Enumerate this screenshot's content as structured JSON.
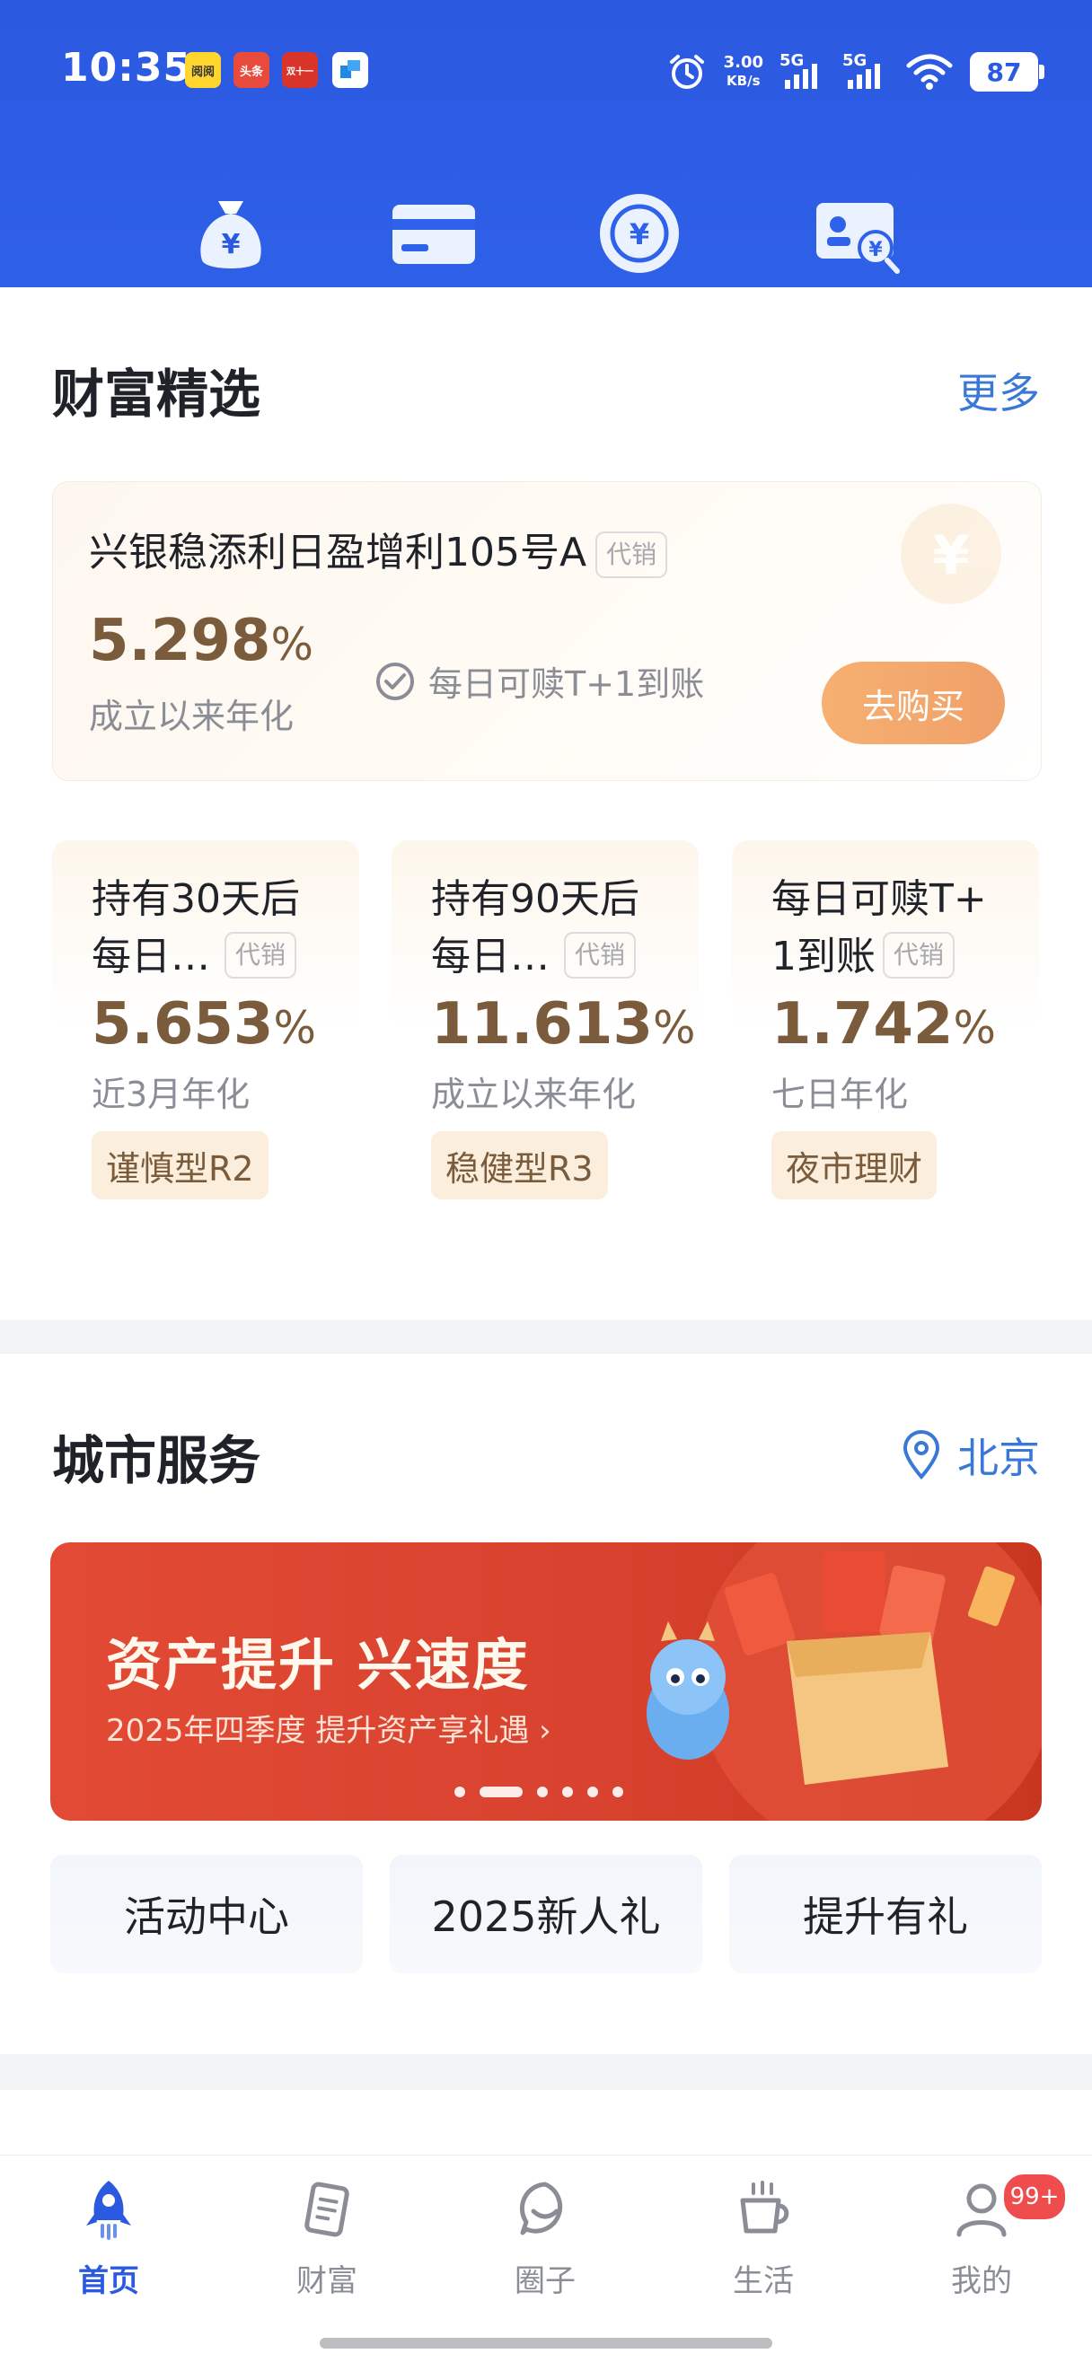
{
  "status_bar": {
    "time": "10:35",
    "notif_apps": [
      "阅阅",
      "头条",
      "双十一",
      ""
    ],
    "net_speed": "3.00",
    "net_speed_unit": "KB/s",
    "signal_1": "5G",
    "signal_2": "5G",
    "battery": "87"
  },
  "quick_icons": [
    "money-bag-icon",
    "card-icon",
    "exchange-icon",
    "id-card-search-icon"
  ],
  "wealth": {
    "title": "财富精选",
    "more": "更多",
    "feature": {
      "name": "兴银稳添利日盈增利105号A",
      "tag": "代销",
      "rate_value": "5.298",
      "rate_unit": "%",
      "rate_label": "成立以来年化",
      "note": "每日可赎T+1到账",
      "buy_label": "去购买"
    },
    "products": [
      {
        "name": "持有30天后每日…",
        "tag": "代销",
        "rate_value": "5.653",
        "rate_unit": "%",
        "rate_label": "近3月年化",
        "risk": "谨慎型R2"
      },
      {
        "name": "持有90天后每日…",
        "tag": "代销",
        "rate_value": "11.613",
        "rate_unit": "%",
        "rate_label": "成立以来年化",
        "risk": "稳健型R3"
      },
      {
        "name": "每日可赎T+1到账",
        "tag": "代销",
        "rate_value": "1.742",
        "rate_unit": "%",
        "rate_label": "七日年化",
        "risk": "夜市理财"
      }
    ]
  },
  "city": {
    "title": "城市服务",
    "location": "北京",
    "banner": {
      "title": "资产提升 兴速度",
      "subtitle": "2025年四季度 提升资产享礼遇 ›",
      "slide_count": 6,
      "active_slide": 1
    },
    "services": [
      "活动中心",
      "2025新人礼",
      "提升有礼"
    ]
  },
  "nav": {
    "items": [
      {
        "label": "首页",
        "icon": "rocket-icon"
      },
      {
        "label": "财富",
        "icon": "wealth-icon"
      },
      {
        "label": "圈子",
        "icon": "chat-face-icon"
      },
      {
        "label": "生活",
        "icon": "coffee-cup-icon"
      },
      {
        "label": "我的",
        "icon": "person-icon"
      }
    ],
    "active_index": 0,
    "badge": "99+"
  },
  "colors": {
    "brand_blue": "#2b59e0",
    "link_blue": "#3a78d8",
    "rate_brown": "#7a5c3c",
    "banner_red": "#e24a35",
    "buy_orange": "#f0a069"
  }
}
